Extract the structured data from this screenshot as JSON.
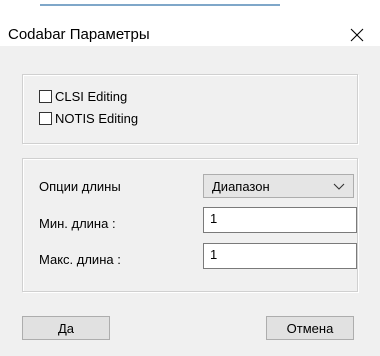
{
  "window": {
    "title": "Codabar Параметры",
    "close_icon": "close-icon"
  },
  "checks": {
    "clsi_label": "CLSI Editing",
    "clsi_checked": false,
    "notis_label": "NOTIS Editing",
    "notis_checked": false
  },
  "length": {
    "options_label": "Опции длины",
    "options_value": "Диапазон",
    "min_label": "Мин. длина :",
    "min_value": "1",
    "max_label": "Макс. длина :",
    "max_value": "1"
  },
  "buttons": {
    "ok_label": "Да",
    "cancel_label": "Отмена"
  }
}
